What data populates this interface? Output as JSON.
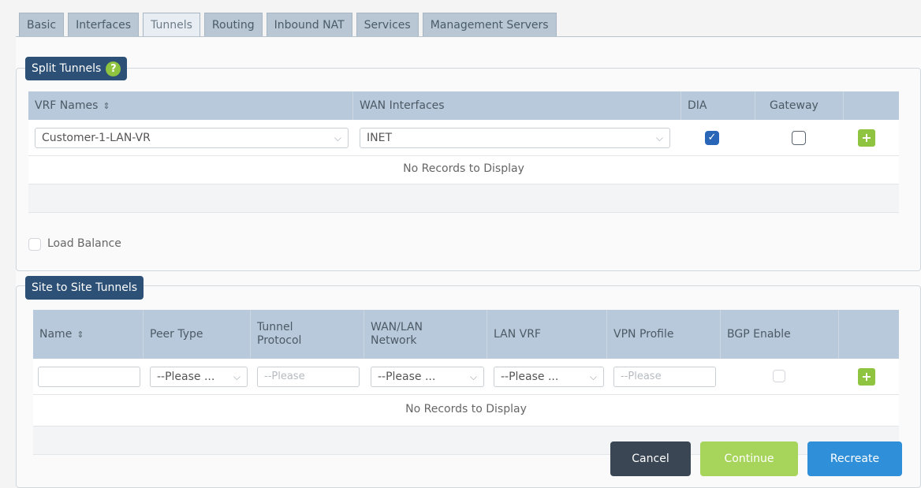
{
  "tabs": [
    "Basic",
    "Interfaces",
    "Tunnels",
    "Routing",
    "Inbound NAT",
    "Services",
    "Management Servers"
  ],
  "split_tunnels": {
    "title": "Split Tunnels",
    "help_icon": "?",
    "columns": {
      "vrf": "VRF Names",
      "wan": "WAN Interfaces",
      "dia": "DIA",
      "gateway": "Gateway"
    },
    "row": {
      "vrf": "Customer-1-LAN-VR",
      "wan": "INET",
      "dia": true,
      "gateway": false
    },
    "empty_text": "No Records to Display",
    "load_balance_label": "Load Balance",
    "add_icon": "+"
  },
  "site_tunnels": {
    "title": "Site to Site Tunnels",
    "columns": {
      "name": "Name",
      "peer_type": "Peer Type",
      "tunnel_protocol": "Tunnel Protocol",
      "wan_lan": "WAN/LAN Network",
      "lan_vrf": "LAN VRF",
      "vpn_profile": "VPN Profile",
      "bgp": "BGP Enable"
    },
    "row": {
      "name": "",
      "peer_type": "--Please ...",
      "tunnel_protocol": "--Please",
      "wan_lan": "--Please ...",
      "lan_vrf": "--Please ...",
      "vpn_profile": "--Please"
    },
    "empty_text": "No Records to Display",
    "add_icon": "+"
  },
  "buttons": {
    "cancel": "Cancel",
    "continue": "Continue",
    "recreate": "Recreate"
  },
  "colors": {
    "cancel": "#3a4654",
    "continue": "#a7d45a",
    "recreate": "#2f8fd8",
    "add": "#8ec43f",
    "legend": "#2d5076"
  }
}
